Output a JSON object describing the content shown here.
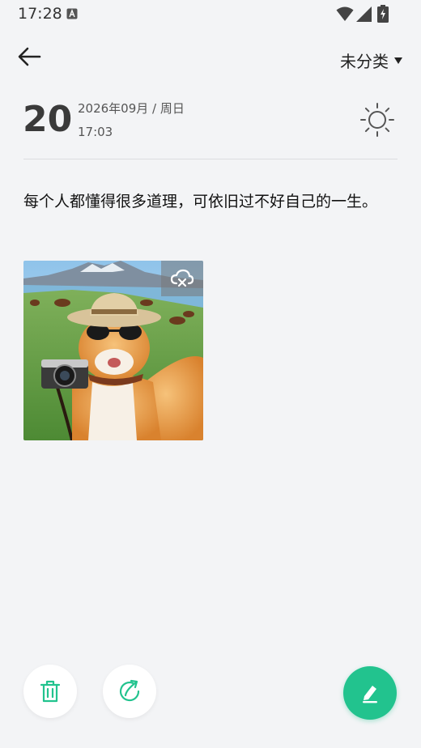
{
  "status_bar": {
    "time": "17:28",
    "icons": [
      "a-icon",
      "wifi-icon",
      "signal-icon",
      "battery-icon"
    ]
  },
  "header": {
    "back_icon": "arrow-left-icon",
    "category": "未分类",
    "dropdown_icon": "triangle-down-icon"
  },
  "entry": {
    "day": "20",
    "date": "2026年09月 / 周日",
    "time": "17:03",
    "weather_icon": "sun-icon",
    "text": "每个人都懂得很多道理，可依旧过不好自己的一生。",
    "photo_badge_icon": "cloud-off-icon"
  },
  "actions": {
    "delete_icon": "trash-icon",
    "share_icon": "share-icon",
    "edit_icon": "pencil-icon"
  },
  "colors": {
    "accent": "#22c38e",
    "background": "#f3f4f6"
  }
}
